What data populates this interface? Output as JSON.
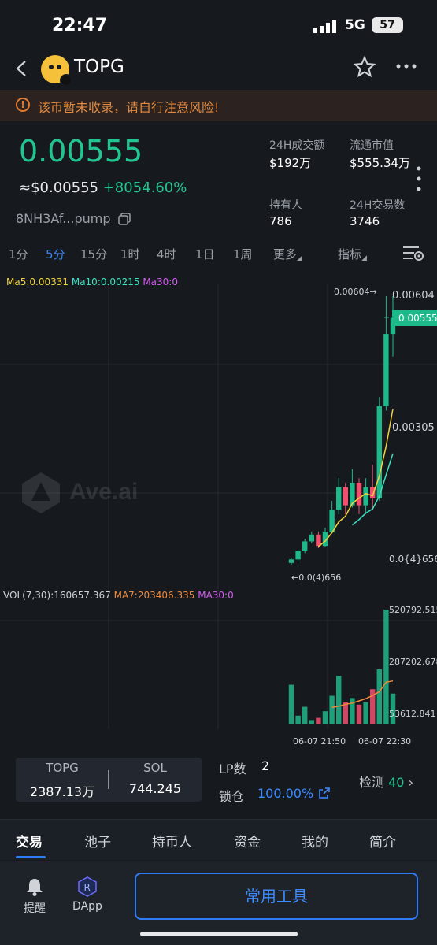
{
  "status_bar": {
    "time": "22:47",
    "network": "5G",
    "battery": "57"
  },
  "header": {
    "title": "TOPG",
    "logo_icon": "token-logo-icon",
    "chain_icon": "solana-icon"
  },
  "warning": {
    "text": "该币暂未收录，请自行注意风险!",
    "color": "#e38a3e"
  },
  "price": {
    "value": "0.00555",
    "usd": "≈$0.00555",
    "change": "+8054.60%",
    "address": "8NH3Af...pump",
    "color_up": "#22c490"
  },
  "stats": [
    {
      "label": "24H成交额",
      "value": "$192万"
    },
    {
      "label": "流通市值",
      "value": "$555.34万"
    },
    {
      "label": "持有人",
      "value": "786"
    },
    {
      "label": "24H交易数",
      "value": "3746"
    }
  ],
  "timeframes": [
    "1分",
    "5分",
    "15分",
    "1时",
    "4时",
    "1日",
    "1周"
  ],
  "timeframe_active": "5分",
  "more_label": "更多",
  "indicator_label": "指标",
  "ma": {
    "ma5": "Ma5:0.00331",
    "ma10": "Ma10:0.00215",
    "ma30": "Ma30:0"
  },
  "vol": {
    "vol": "VOL(7,30):160657.367",
    "ma7": "MA7:203406.335",
    "ma30": "MA30:0"
  },
  "watermark": "Ave.ai",
  "price_axis": {
    "high": "0.00604",
    "current": "0.00555",
    "mid": "0.00305",
    "low": "0.0{4}656"
  },
  "chart_markers": {
    "high": "0.00604→",
    "low": "←0.0(4)656"
  },
  "vol_axis": {
    "top": "520792.515",
    "mid": "287202.678",
    "low": "53612.841"
  },
  "time_axis": {
    "t1": "06-07 21:50",
    "t2": "06-07 22:30"
  },
  "chart_data": {
    "type": "candlestick",
    "candles": [
      {
        "o": 0.00012,
        "c": 0.0002,
        "h": 0.00024,
        "l": 8e-05
      },
      {
        "o": 0.0002,
        "c": 0.00038,
        "h": 0.00042,
        "l": 0.00016
      },
      {
        "o": 0.00038,
        "c": 0.0006,
        "h": 0.00066,
        "l": 0.00034
      },
      {
        "o": 0.0006,
        "c": 0.00075,
        "h": 0.00082,
        "l": 0.00056
      },
      {
        "o": 0.00075,
        "c": 0.0005,
        "h": 0.00082,
        "l": 0.00045
      },
      {
        "o": 0.0005,
        "c": 0.0008,
        "h": 0.0009,
        "l": 0.00048
      },
      {
        "o": 0.0008,
        "c": 0.0013,
        "h": 0.0015,
        "l": 0.00078
      },
      {
        "o": 0.0013,
        "c": 0.0018,
        "h": 0.002,
        "l": 0.0012
      },
      {
        "o": 0.0018,
        "c": 0.0014,
        "h": 0.0019,
        "l": 0.0012
      },
      {
        "o": 0.0014,
        "c": 0.0019,
        "h": 0.0022,
        "l": 0.00135
      },
      {
        "o": 0.0019,
        "c": 0.0014,
        "h": 0.002,
        "l": 0.0012
      },
      {
        "o": 0.0014,
        "c": 0.0018,
        "h": 0.002,
        "l": 0.0012
      },
      {
        "o": 0.0018,
        "c": 0.00155,
        "h": 0.0023,
        "l": 0.0013
      },
      {
        "o": 0.00155,
        "c": 0.0036,
        "h": 0.0038,
        "l": 0.0015
      },
      {
        "o": 0.0036,
        "c": 0.0052,
        "h": 0.00604,
        "l": 0.0035
      },
      {
        "o": 0.0052,
        "c": 0.00555,
        "h": 0.00604,
        "l": 0.0047
      }
    ],
    "volumes": [
      180000,
      40000,
      80000,
      20000,
      30000,
      60000,
      130000,
      220000,
      100000,
      120000,
      90000,
      100000,
      160000,
      250000,
      520792,
      140000
    ],
    "ylim": [
      6.56e-05,
      0.00604
    ]
  },
  "balance": {
    "token_label": "TOPG",
    "token_value": "2387.13万",
    "sol_label": "SOL",
    "sol_value": "744.245"
  },
  "lp": {
    "label": "LP数",
    "value": "2",
    "lock_label": "锁仓",
    "lock_value": "100.00%"
  },
  "check": {
    "label": "检测",
    "value": "40"
  },
  "tabs": [
    "交易",
    "池子",
    "持币人",
    "资金",
    "我的",
    "简介"
  ],
  "bottom": {
    "alert": "提醒",
    "dapp": "DApp",
    "tools": "常用工具"
  }
}
